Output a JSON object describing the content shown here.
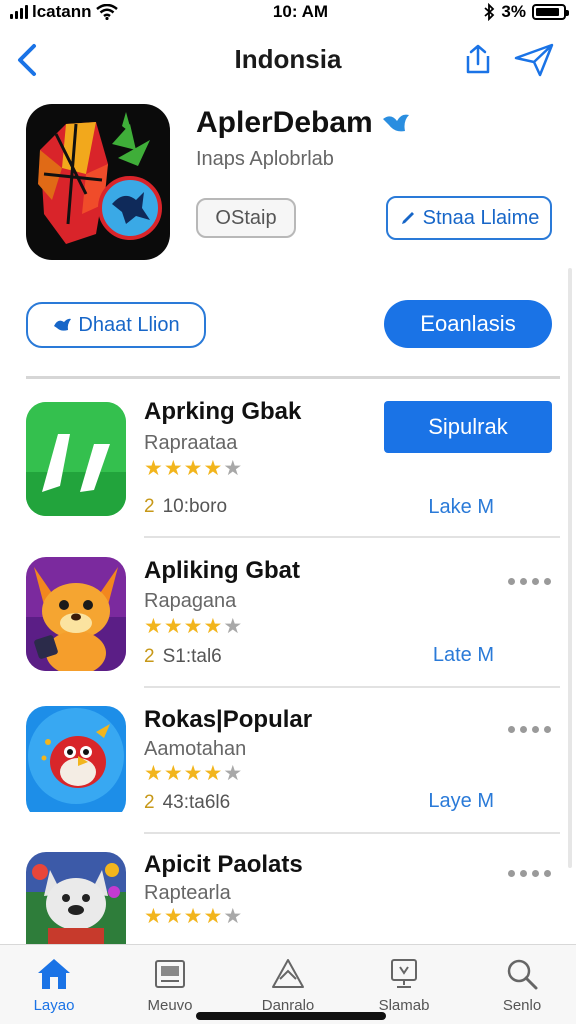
{
  "status_bar": {
    "carrier": "lcatann",
    "time": "10: AM",
    "battery_text": "3%",
    "battery_level_pct": 90
  },
  "nav": {
    "title": "Indonsia",
    "back_icon": "chevron-left-icon",
    "share_icon": "share-icon",
    "send_icon": "paper-plane-icon"
  },
  "app": {
    "name": "AplerDebam",
    "subtitle": "Inaps Aplobrlab",
    "primary_button": "OStaip",
    "save_button": "Stnaa Llaime",
    "left_pill_button": "Dhaat Llion",
    "solid_pill_button": "Eoanlasis"
  },
  "list": [
    {
      "title": "Aprking Gbak",
      "subtitle": "Rapraataa",
      "rating": 4,
      "rating_max": 5,
      "meta_lead": "2",
      "meta": "10:boro",
      "action": "Sipulrak",
      "link": "Lake M"
    },
    {
      "title": "Apliking Gbat",
      "subtitle": "Rapagana",
      "rating": 4,
      "rating_max": 5,
      "meta_lead": "2",
      "meta": "S1:tal6",
      "link": "Late M"
    },
    {
      "title": "Rokas|Popular",
      "subtitle": "Aamotahan",
      "rating": 4,
      "rating_max": 5,
      "meta_lead": "2",
      "meta": "43:ta6l6",
      "link": "Laye M"
    },
    {
      "title": "Apicit Paolats",
      "subtitle": "Raptearla",
      "rating": 4,
      "rating_max": 5
    }
  ],
  "tabbar": {
    "tabs": [
      {
        "label": "Layao",
        "icon": "home-icon",
        "active": true
      },
      {
        "label": "Meuvo",
        "icon": "news-icon",
        "active": false
      },
      {
        "label": "Danralo",
        "icon": "apps-icon",
        "active": false
      },
      {
        "label": "Slamab",
        "icon": "arcade-icon",
        "active": false
      },
      {
        "label": "Senlo",
        "icon": "search-icon",
        "active": false
      }
    ]
  },
  "colors": {
    "accent": "#1a73e6",
    "star": "#f2b51d"
  }
}
